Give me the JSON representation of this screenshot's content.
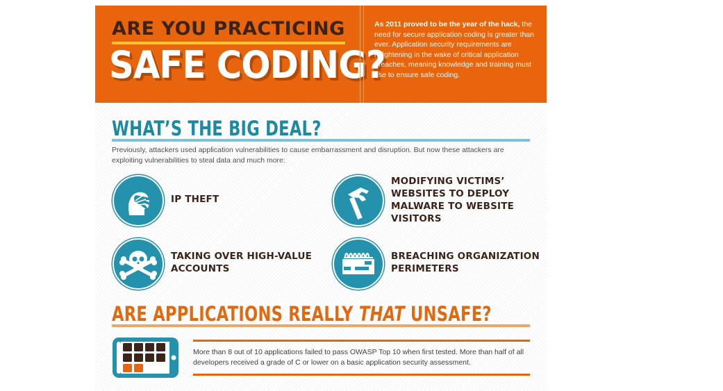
{
  "banner": {
    "title_line1": "ARE YOU PRACTICING",
    "title_line2": "SAFE CODING?",
    "intro_bold": "As 2011 proved to be the year of the hack,",
    "intro_rest": "the need for secure application coding is greater than ever. Application security requirements are heightening in the wake of critical application breaches, meaning knowledge and training must rise to ensure safe coding."
  },
  "big_deal": {
    "heading": "WHAT’S THE BIG DEAL?",
    "paragraph": "Previously, attackers used application vulnerabilities to cause embarrassment and disruption. But now these attackers are exploiting vulnerabilities to steal data and much more:",
    "items": [
      {
        "label": "IP THEFT",
        "icon": "head-hand-icon"
      },
      {
        "label": "MODIFYING VICTIMS’\nWEBSITES TO DEPLOY\nMALWARE TO WEBSITE\nVISITORS",
        "icon": "hammer-icon"
      },
      {
        "label": "TAKING OVER HIGH-VALUE\nACCOUNTS",
        "icon": "skull-crossbones-icon"
      },
      {
        "label": "BREACHING ORGANIZATION\nPERIMETERS",
        "icon": "breached-wall-icon"
      }
    ]
  },
  "unsafe": {
    "heading_pre": "ARE APPLICATIONS REALLY ",
    "heading_em": "THAT",
    "heading_post": " UNSAFE?",
    "stat": "More than 8 out of 10 applications failed to pass OWASP Top 10 when first tested. More than half of all developers received a grade of C or lower on a basic application security assessment.",
    "tablet_icon": "tablet-grid-icon",
    "grid_total": 10,
    "grid_failed": 8
  },
  "colors": {
    "orange": "#e8650d",
    "teal": "#2592ad",
    "brown": "#3b2417",
    "yellow": "#f4c531"
  }
}
